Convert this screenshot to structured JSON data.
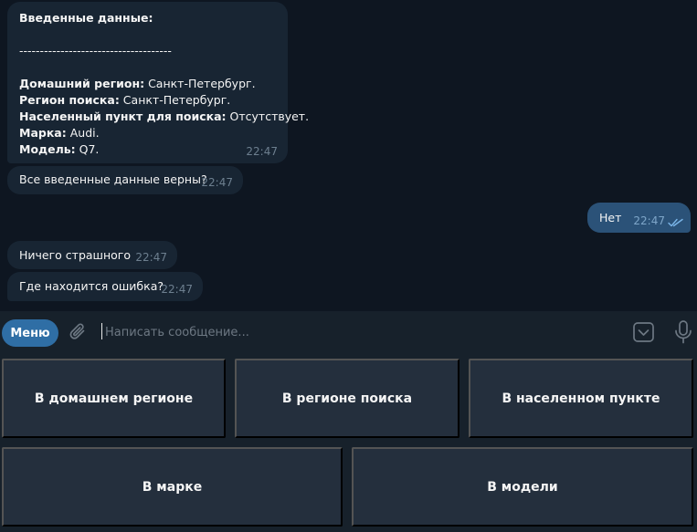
{
  "messages": {
    "summary": {
      "heading": "Введенные данные:",
      "divider": "-------------------------------------",
      "fields": [
        {
          "label": "Домашний регион:",
          "value": " Санкт-Петербург."
        },
        {
          "label": "Регион поиска:",
          "value": " Санкт-Петербург."
        },
        {
          "label": "Населенный пункт для поиска:",
          "value": " Отсутствует."
        },
        {
          "label": "Марка:",
          "value": " Audi."
        },
        {
          "label": "Модель:",
          "value": " Q7."
        }
      ],
      "time": "22:47"
    },
    "confirm": {
      "text": "Все введенные данные верны?",
      "time": "22:47"
    },
    "reply_no": {
      "text": "Нет",
      "time": "22:47"
    },
    "no_worries": {
      "text": "Ничего страшного",
      "time": "22:47"
    },
    "where_error": {
      "text": "Где находится ошибка?",
      "time": "22:47"
    }
  },
  "input_bar": {
    "menu_label": "Меню",
    "placeholder": "Написать сообщение..."
  },
  "keyboard": {
    "buttons": [
      "В домашнем регионе",
      "В регионе поиска",
      "В населенном пункте",
      "В марке",
      "В модели"
    ]
  },
  "colors": {
    "background": "#0e1621",
    "bubble_in": "#182533",
    "bubble_out": "#2b5278",
    "panel": "#17212b",
    "key": "#242f3d",
    "accent": "#2f6ea5"
  },
  "icons": [
    "paperclip-icon",
    "keyboard-toggle-icon",
    "microphone-icon",
    "double-check-icon"
  ]
}
